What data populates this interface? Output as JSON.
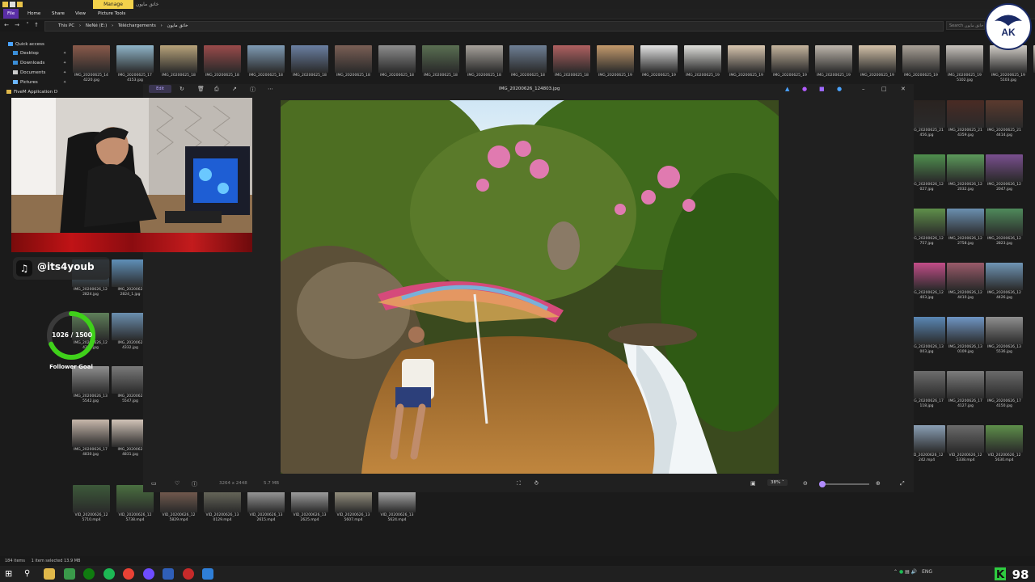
{
  "window": {
    "context_tab": "Manage",
    "title": "خاتق مايون"
  },
  "ribbon": {
    "tabs": [
      "File",
      "Home",
      "Share",
      "View",
      "Picture Tools"
    ]
  },
  "address": {
    "crumbs": [
      "This PC",
      "NeNé (E:)",
      "Téléchargements",
      "خاتق مايون"
    ],
    "search_placeholder": "Search خاتق مايون"
  },
  "navpane": {
    "items": [
      "Quick access",
      "Desktop",
      "Downloads",
      "Documents",
      "Pictures",
      "FiveM Application D"
    ]
  },
  "top_thumbs": [
    {
      "label": "IMG_20200625_14\n4220.jpg",
      "color": "#8a5a4a"
    },
    {
      "label": "IMG_20200625_17\n4153.jpg",
      "color": "#8fb5c9"
    },
    {
      "label": "IMG_20200625_18",
      "color": "#b8a37a"
    },
    {
      "label": "IMG_20200625_18",
      "color": "#9a4a4a"
    },
    {
      "label": "IMG_20200625_18",
      "color": "#7f9bb5"
    },
    {
      "label": "IMG_20200625_18",
      "color": "#6a7fa2"
    },
    {
      "label": "IMG_20200625_18",
      "color": "#7a5f55"
    },
    {
      "label": "IMG_20200625_18",
      "color": "#8d8d8d"
    },
    {
      "label": "IMG_20200625_18",
      "color": "#5a6f52"
    },
    {
      "label": "IMG_20200625_18",
      "color": "#a7a29b"
    },
    {
      "label": "IMG_20200625_18",
      "color": "#6e7f95"
    },
    {
      "label": "IMG_20200625_18",
      "color": "#b06060"
    },
    {
      "label": "IMG_20200625_19",
      "color": "#c49a6c"
    },
    {
      "label": "IMG_20200625_19",
      "color": "#e4e4e4"
    },
    {
      "label": "IMG_20200625_19",
      "color": "#e0e0dc"
    },
    {
      "label": "IMG_20200625_19",
      "color": "#d9c7b0"
    },
    {
      "label": "IMG_20200625_19",
      "color": "#c5b49d"
    },
    {
      "label": "IMG_20200625_19",
      "color": "#bfb7ad"
    },
    {
      "label": "IMG_20200625_19",
      "color": "#d4c2a9"
    },
    {
      "label": "IMG_20200625_19",
      "color": "#aaa298"
    },
    {
      "label": "IMG_20200625_19\n5102.jpg",
      "color": "#c9c4be"
    },
    {
      "label": "IMG_20200625_19\n5103.jpg",
      "color": "#d3cfc9"
    },
    {
      "label": "IMG_20200625_19\n5152.jpg",
      "color": "#c7bfb4"
    }
  ],
  "right_thumbs": [
    {
      "label": "IMG_20200625_21\n456.jpg",
      "color": "#2a2320"
    },
    {
      "label": "IMG_20200625_21\n4359.jpg",
      "color": "#4a2b24"
    },
    {
      "label": "IMG_20200625_21\n4414.jpg",
      "color": "#5b3a2e"
    },
    {
      "label": "IMG_20200626_12\n027.jpg",
      "color": "#4f8f4e"
    },
    {
      "label": "IMG_20200626_12\n2032.jpg",
      "color": "#5c9a5b"
    },
    {
      "label": "IMG_20200626_12\n2047.jpg",
      "color": "#7a4f8f"
    },
    {
      "label": "IMG_20200626_12\n757.jpg",
      "color": "#5f8f4a"
    },
    {
      "label": "IMG_20200626_12\n2758.jpg",
      "color": "#6b8fb0"
    },
    {
      "label": "IMG_20200626_12\n2823.jpg",
      "color": "#4f8a5b"
    },
    {
      "label": "IMG_20200626_12\n403.jpg",
      "color": "#c34d88"
    },
    {
      "label": "IMG_20200626_12\n4410.jpg",
      "color": "#9a5a6a"
    },
    {
      "label": "IMG_20200626_12\n4426.jpg",
      "color": "#6f95b5"
    },
    {
      "label": "IMG_20200626_13\n003.jpg",
      "color": "#5a87b5"
    },
    {
      "label": "IMG_20200626_13\n0109.jpg",
      "color": "#6f96c5"
    },
    {
      "label": "IMG_20200626_13\n5536.jpg",
      "color": "#8f8f8f"
    },
    {
      "label": "IMG_20200626_17\n118.jpg",
      "color": "#6d6d6d"
    },
    {
      "label": "IMG_20200626_17\n4127.jpg",
      "color": "#7d7d7d"
    },
    {
      "label": "IMG_20200626_17\n4150.jpg",
      "color": "#6a6a6a"
    },
    {
      "label": "VID_20200626_12\n242.mp4",
      "color": "#8a9fb5"
    },
    {
      "label": "VID_20200626_12\n5338.mp4",
      "color": "#6b6b6b"
    },
    {
      "label": "VID_20200626_12\n5630.mp4",
      "color": "#5e8f4a"
    }
  ],
  "left_thumbs": [
    {
      "label": "IMG_20200626_12\n2824.jpg",
      "color": "#5b7f9a"
    },
    {
      "label": "IMG_2020062\n2824_1.jpg",
      "color": "#5f8fb8"
    },
    {
      "label": "IMG_20200626_12\n4332.jpg",
      "color": "#5f7f5a"
    },
    {
      "label": "IMG_2020062\n4332.jpg",
      "color": "#6b8fb0"
    },
    {
      "label": "IMG_20200626_13\n5542.jpg",
      "color": "#8f8f8f"
    },
    {
      "label": "IMG_2020062\n5547.jpg",
      "color": "#7a7a7a"
    },
    {
      "label": "IMG_20200626_17\n4830.jpg",
      "color": "#c8b8ac"
    },
    {
      "label": "IMG_2020062\n4831.jpg",
      "color": "#d2c4b8"
    }
  ],
  "bottom_thumbs": [
    {
      "label": "VID_20200626_12\n5710.mp4",
      "color": "#3d5a3a"
    },
    {
      "label": "VID_20200626_12\n5738.mp4",
      "color": "#4a7040"
    },
    {
      "label": "VID_20200626_12\n5829.mp4",
      "color": "#8a6a5a"
    },
    {
      "label": "VID_20200626_13\n0129.mp4",
      "color": "#7a7a6a"
    },
    {
      "label": "VID_20200626_13\n2615.mp4",
      "color": "#bcbcbc"
    },
    {
      "label": "VID_20200626_13\n2625.mp4",
      "color": "#c5c5c5"
    },
    {
      "label": "VID_20200626_13\n5607.mp4",
      "color": "#b9b29b"
    },
    {
      "label": "VID_20200626_13\n5624.mp4",
      "color": "#cfcfcf"
    }
  ],
  "viewer": {
    "title": "IMG_20200626_124803.jpg",
    "edit_label": "Edit",
    "dimensions": "3264 x 2448",
    "file_size": "5.7 MB",
    "zoom": "38%",
    "zoom_level": 0.0
  },
  "overlay": {
    "tiktok_handle": "@its4youb",
    "goal_text": "1026 / 1500",
    "goal_label": "Follower Goal",
    "goal_progress": 0.684
  },
  "status": {
    "items_count": "184 items",
    "selected": "1 item selected  13.9 MB"
  },
  "tray": {
    "lang": "ENG",
    "badge": "98"
  },
  "colors": {
    "accent": "#5a2ea6",
    "manage_tab": "#f2d14b",
    "goal_ring": "#3fd11a",
    "k_logo": "#2ecc40"
  }
}
